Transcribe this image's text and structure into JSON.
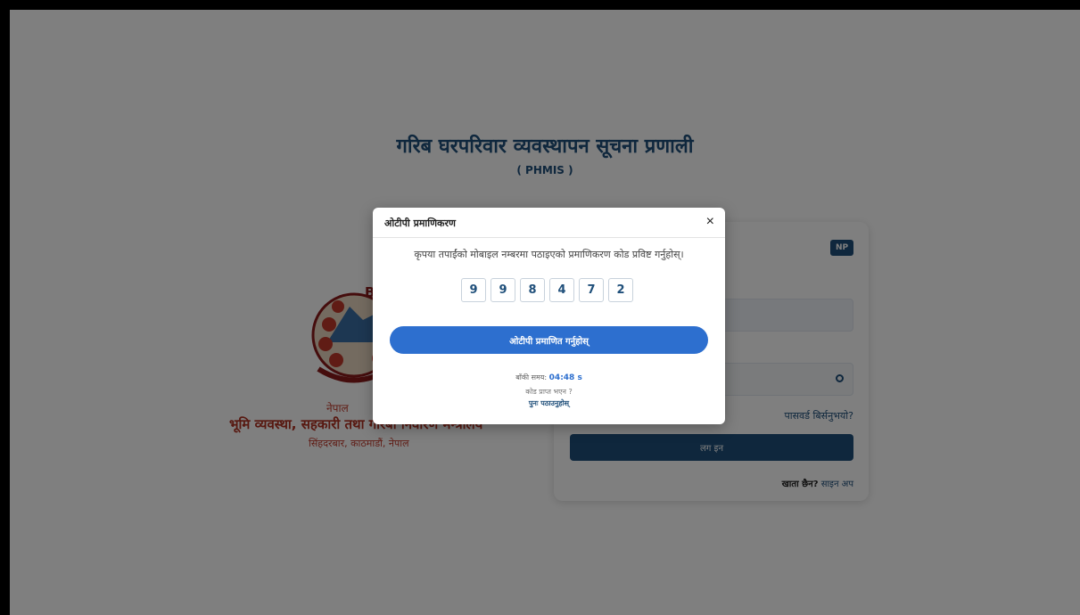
{
  "header": {
    "title": "गरिब घरपरिवार व्यवस्थापन सूचना प्रणाली",
    "subtitle": "( PHMIS )"
  },
  "left_panel": {
    "emblem_text": "B",
    "country": "नेपाल",
    "ministry": "भूमि व्यवस्था, सहकारी तथा गरिबी निवारण मन्त्रालय",
    "address": "सिंहदरबार, काठमाडौं, नेपाल"
  },
  "login_card": {
    "language_badge": "NP",
    "forgot_password": "पासवर्ड बिर्सनुभयो?",
    "login_button": "लग इन",
    "no_account": "खाता छैन?",
    "signup_link": "साइन अप"
  },
  "otp_modal": {
    "title": "ओटीपी प्रमाणिकरण",
    "close_symbol": "×",
    "message": "कृपया तपाईंको मोबाइल नम्बरमा पठाइएको प्रमाणिकरण कोड प्रविष्ट गर्नुहोस्।",
    "otp_digits": [
      "9",
      "9",
      "8",
      "4",
      "7",
      "2"
    ],
    "verify_button": "ओटीपी प्रमाणित गर्नुहोस्",
    "remaining_label": "बाँकी समय:",
    "remaining_value": "04:48 s",
    "not_received": "कोड प्राप्त भएन ?",
    "resend": "पुनः पठाउनुहोस्"
  },
  "colors": {
    "primary": "#1f4f7a",
    "accent": "#2d6fcf",
    "ministry_red": "#b03020"
  }
}
